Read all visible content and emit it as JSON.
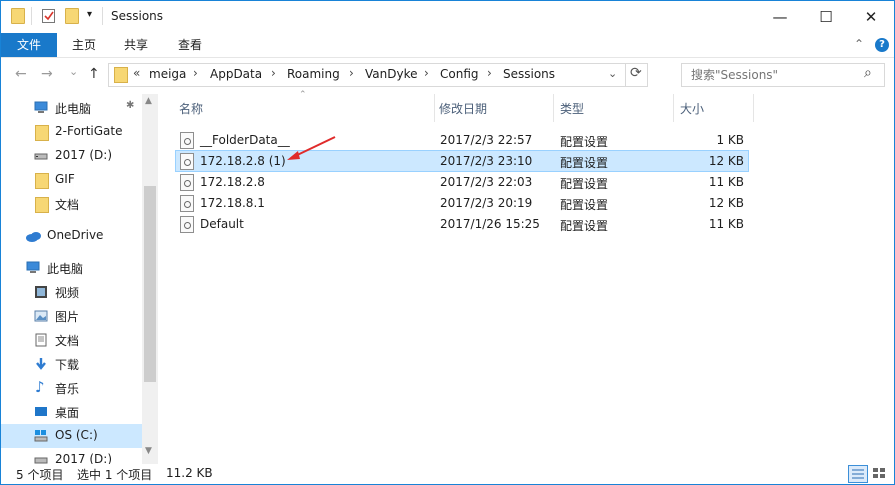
{
  "window": {
    "title": "Sessions",
    "minimize": "—",
    "maximize": "☐",
    "close": "✕"
  },
  "ribbon": {
    "tabs": [
      "文件",
      "主页",
      "共享",
      "查看"
    ],
    "expand": "⌃",
    "help": "?"
  },
  "nav": {
    "back": "←",
    "forward": "→",
    "recent": "⌄",
    "up": "↑",
    "overflow": "«",
    "breadcrumbs": [
      "meiga",
      "AppData",
      "Roaming",
      "VanDyke",
      "Config",
      "Sessions"
    ],
    "dropdown": "⌄",
    "refresh": "⟳"
  },
  "search": {
    "placeholder": "搜索\"Sessions\"",
    "icon": "⌕"
  },
  "sidebar": {
    "items": [
      {
        "label": "此电脑",
        "icon": "computer-icon"
      },
      {
        "label": "2-FortiGate",
        "icon": "folder-icon"
      },
      {
        "label": "2017 (D:)",
        "icon": "drive-icon"
      },
      {
        "label": "GIF",
        "icon": "folder-icon"
      },
      {
        "label": "文档",
        "icon": "folder-icon"
      },
      {
        "label": "OneDrive",
        "icon": "cloud-icon"
      },
      {
        "label": "此电脑",
        "icon": "computer-icon"
      },
      {
        "label": "视频",
        "icon": "video-icon"
      },
      {
        "label": "图片",
        "icon": "picture-icon"
      },
      {
        "label": "文档",
        "icon": "document-icon"
      },
      {
        "label": "下载",
        "icon": "download-icon"
      },
      {
        "label": "音乐",
        "icon": "music-icon"
      },
      {
        "label": "桌面",
        "icon": "desktop-icon"
      },
      {
        "label": "OS (C:)",
        "icon": "drive-icon"
      },
      {
        "label": "2017 (D:)",
        "icon": "drive-icon"
      }
    ],
    "pin": "📌"
  },
  "list": {
    "columns": [
      "名称",
      "修改日期",
      "类型",
      "大小"
    ],
    "rows": [
      {
        "name": "__FolderData__",
        "date": "2017/2/3 22:57",
        "type": "配置设置",
        "size": "1 KB"
      },
      {
        "name": "172.18.2.8 (1)",
        "date": "2017/2/3 23:10",
        "type": "配置设置",
        "size": "12 KB"
      },
      {
        "name": "172.18.2.8",
        "date": "2017/2/3 22:03",
        "type": "配置设置",
        "size": "11 KB"
      },
      {
        "name": "172.18.8.1",
        "date": "2017/2/3 20:19",
        "type": "配置设置",
        "size": "12 KB"
      },
      {
        "name": "Default",
        "date": "2017/1/26 15:25",
        "type": "配置设置",
        "size": "11 KB"
      }
    ]
  },
  "status": {
    "count": "5 个项目",
    "selection": "选中 1 个项目",
    "size": "11.2 KB"
  },
  "colors": {
    "accent": "#1979ca",
    "selection": "#cce8ff",
    "arrow": "#e02b2b"
  }
}
